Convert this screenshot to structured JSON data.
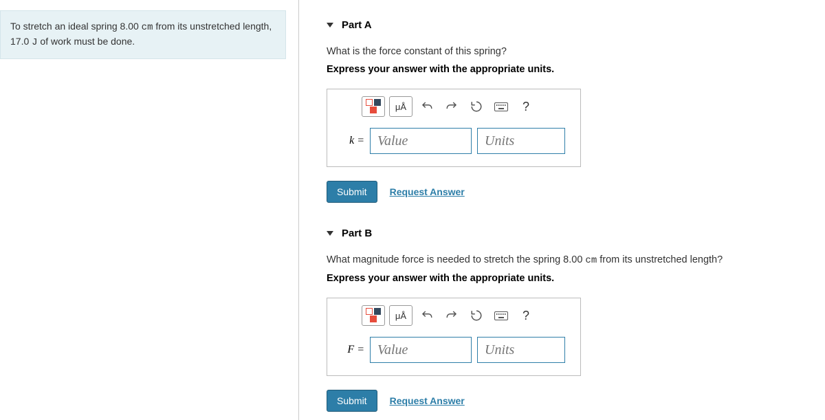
{
  "problem": {
    "text_before_dist": "To stretch an ideal spring ",
    "distance": "8.00 ",
    "dist_unit": "cm",
    "text_mid": " from its unstretched length, ",
    "work": "17.0 ",
    "work_unit": "J",
    "text_after": " of work must be done."
  },
  "parts": [
    {
      "label": "Part A",
      "question": "What is the force constant of this spring?",
      "instruction": "Express your answer with the appropriate units.",
      "variable": "k =",
      "value_placeholder": "Value",
      "units_placeholder": "Units",
      "units_tool": "μÅ",
      "submit": "Submit",
      "request": "Request Answer"
    },
    {
      "label": "Part B",
      "question_before": "What magnitude force is needed to stretch the spring ",
      "question_dist": "8.00 ",
      "question_unit": "cm",
      "question_after": " from its unstretched length?",
      "instruction": "Express your answer with the appropriate units.",
      "variable": "F =",
      "value_placeholder": "Value",
      "units_placeholder": "Units",
      "units_tool": "μÅ",
      "submit": "Submit",
      "request": "Request Answer"
    }
  ]
}
